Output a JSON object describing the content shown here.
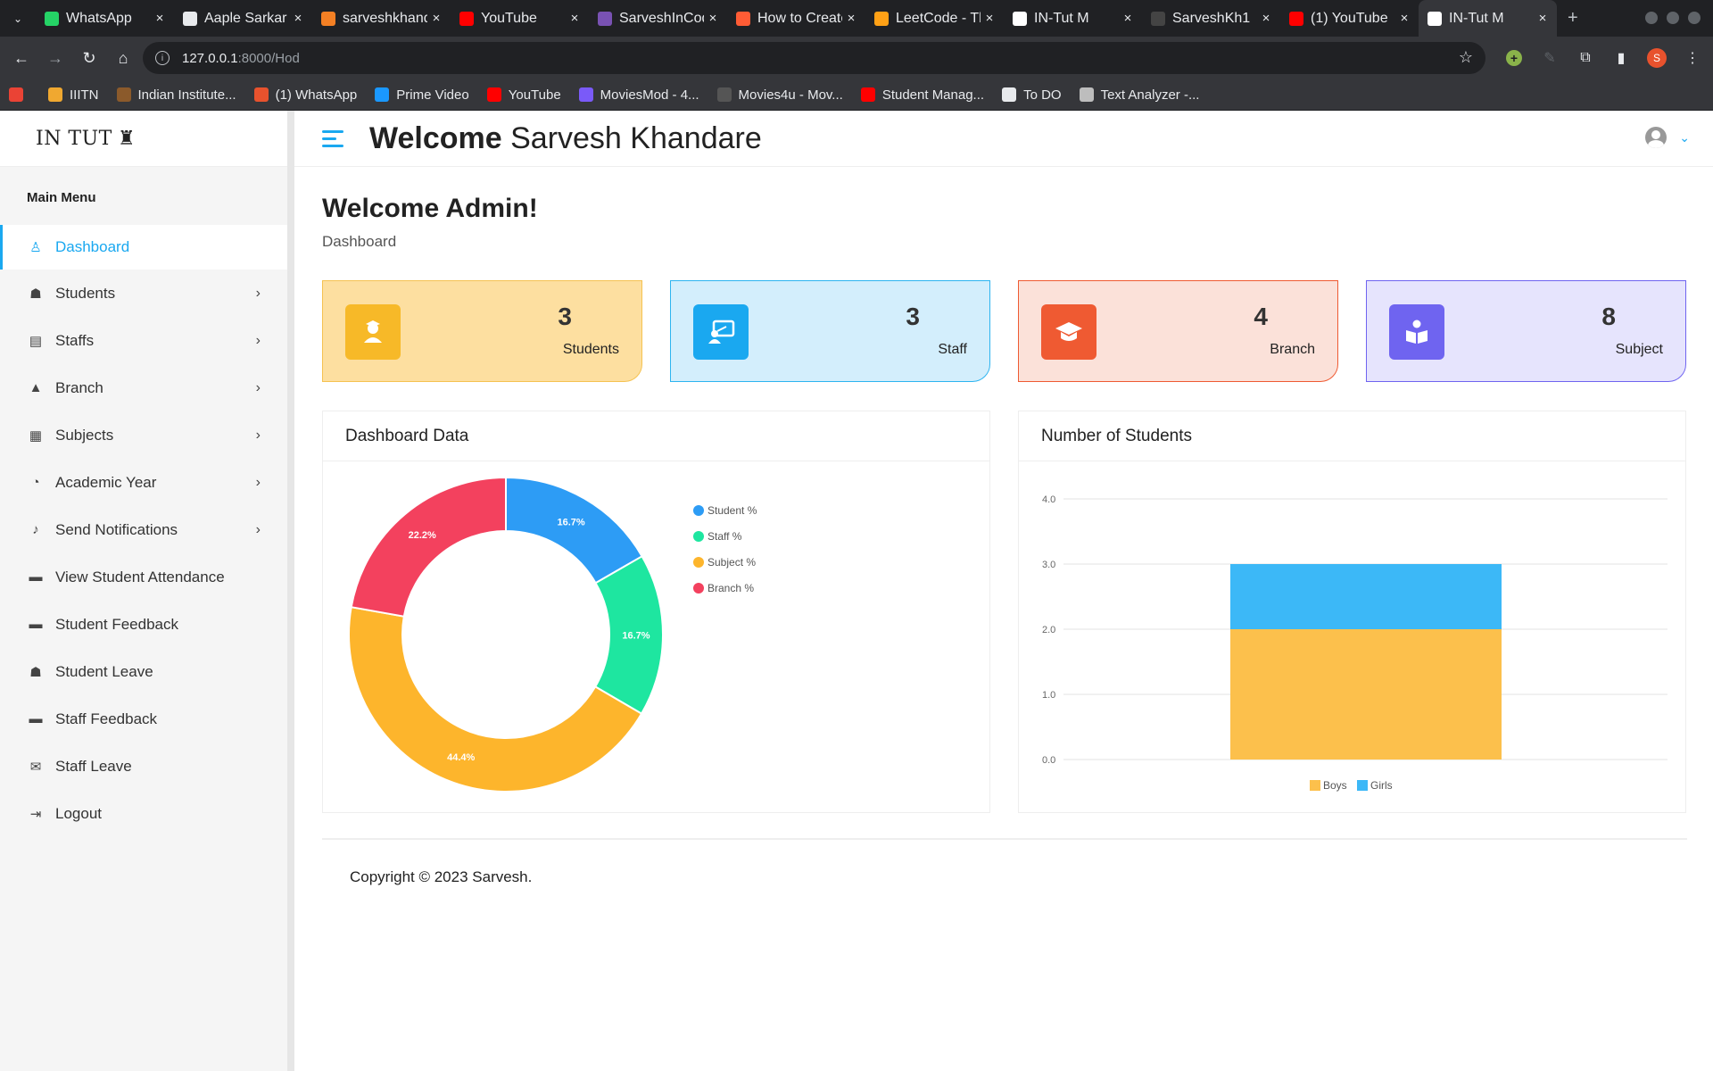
{
  "browser": {
    "tabs": [
      {
        "title": "WhatsApp",
        "icon": "whatsapp-icon",
        "color": "#25d366"
      },
      {
        "title": "Aaple Sarkar",
        "icon": "document-icon",
        "color": "#e8eaed"
      },
      {
        "title": "sarveshkhandare",
        "icon": "stackoverflow-icon",
        "color": "#f48024"
      },
      {
        "title": "YouTube",
        "icon": "youtube-icon",
        "color": "#ff0000"
      },
      {
        "title": "SarveshInCode",
        "icon": "bootstrap-icon",
        "color": "#7952b3"
      },
      {
        "title": "How to Create",
        "icon": "hubspot-icon",
        "color": "#ff5c35"
      },
      {
        "title": "LeetCode - The",
        "icon": "leetcode-icon",
        "color": "#ffa116"
      },
      {
        "title": "IN-Tut M",
        "icon": "intut-icon",
        "color": "#ffffff"
      },
      {
        "title": "SarveshKh1",
        "icon": "github-icon",
        "color": "#444"
      },
      {
        "title": "(1) YouTube",
        "icon": "youtube-icon",
        "color": "#ff0000"
      },
      {
        "title": "IN-Tut M",
        "icon": "intut-icon",
        "color": "#ffffff",
        "active": true
      }
    ],
    "new_tab": "+",
    "url_host": "127.0.0.1",
    "url_path": ":8000/Hod",
    "profile_initial": "S",
    "bookmarks": [
      {
        "label": "",
        "icon": "gmail-icon",
        "color": "#ea4335"
      },
      {
        "label": "IIITN",
        "icon": "iiitn-icon",
        "color": "#f0a830"
      },
      {
        "label": "Indian Institute...",
        "icon": "institute-icon",
        "color": "#8b5a2b"
      },
      {
        "label": "(1) WhatsApp",
        "icon": "whatsapp-icon",
        "color": "#e8522d"
      },
      {
        "label": "Prime Video",
        "icon": "prime-video-icon",
        "color": "#1a98ff"
      },
      {
        "label": "YouTube",
        "icon": "youtube-icon",
        "color": "#ff0000"
      },
      {
        "label": "MoviesMod - 4...",
        "icon": "moviesmod-icon",
        "color": "#7a5af8"
      },
      {
        "label": "Movies4u - Mov...",
        "icon": "movies4u-icon",
        "color": "#555"
      },
      {
        "label": "Student Manag...",
        "icon": "youtube-icon",
        "color": "#ff0000"
      },
      {
        "label": "To DO",
        "icon": "globe-icon",
        "color": "#e8eaed"
      },
      {
        "label": "Text Analyzer -...",
        "icon": "gear-icon",
        "color": "#bdbdbd"
      }
    ]
  },
  "app": {
    "logo_text": "IN TUT",
    "header_welcome": "Welcome",
    "header_user": "Sarvesh Khandare",
    "menu_title": "Main Menu",
    "menu": [
      {
        "label": "Dashboard",
        "icon": "dashboard-icon",
        "active": true,
        "chevron": false
      },
      {
        "label": "Students",
        "icon": "student-icon",
        "chevron": true
      },
      {
        "label": "Staffs",
        "icon": "staff-icon",
        "chevron": true
      },
      {
        "label": "Branch",
        "icon": "graduation-cap-icon",
        "chevron": true
      },
      {
        "label": "Subjects",
        "icon": "book-reader-icon",
        "chevron": true
      },
      {
        "label": "Academic Year",
        "icon": "clock-icon",
        "chevron": true
      },
      {
        "label": "Send Notifications",
        "icon": "bell-icon",
        "chevron": true
      },
      {
        "label": "View Student Attendance",
        "icon": "comments-icon",
        "chevron": false
      },
      {
        "label": "Student Feedback",
        "icon": "comments-icon",
        "chevron": false
      },
      {
        "label": "Student Leave",
        "icon": "student-icon",
        "chevron": false
      },
      {
        "label": "Staff Feedback",
        "icon": "comments-icon",
        "chevron": false
      },
      {
        "label": "Staff Leave",
        "icon": "envelope-icon",
        "chevron": false
      },
      {
        "label": "Logout",
        "icon": "logout-icon",
        "chevron": false
      }
    ],
    "page_title": "Welcome Admin!",
    "breadcrumb": "Dashboard",
    "cards": [
      {
        "value": "3",
        "label": "Students",
        "icon": "student-icon",
        "icon_bg": "#f7b928"
      },
      {
        "value": "3",
        "label": "Staff",
        "icon": "teacher-icon",
        "icon_bg": "#1aa8f0"
      },
      {
        "value": "4",
        "label": "Branch",
        "icon": "graduation-cap-icon",
        "icon_bg": "#ef5a32"
      },
      {
        "value": "8",
        "label": "Subject",
        "icon": "book-reader-icon",
        "icon_bg": "#6f64f0"
      }
    ],
    "panel_left_title": "Dashboard Data",
    "panel_right_title": "Number of Students",
    "footer": "Copyright © 2023 Sarvesh."
  },
  "chart_data": [
    {
      "type": "pie",
      "variant": "doughnut",
      "categories": [
        "Student %",
        "Staff %",
        "Subject %",
        "Branch %"
      ],
      "values": [
        16.7,
        16.7,
        44.4,
        22.2
      ],
      "value_labels": [
        "16.7%",
        "16.7%",
        "44.4%",
        "22.2%"
      ],
      "colors": [
        "#2d9cf5",
        "#1ee6a0",
        "#fdb52c",
        "#f3415e"
      ],
      "legend_position": "right"
    },
    {
      "type": "bar",
      "stacked": true,
      "categories": [
        ""
      ],
      "series": [
        {
          "name": "Boys",
          "values": [
            2
          ],
          "color": "#fcc04c"
        },
        {
          "name": "Girls",
          "values": [
            1
          ],
          "color": "#3cb8f7"
        }
      ],
      "yticks": [
        "0.0",
        "1.0",
        "2.0",
        "3.0",
        "4.0"
      ],
      "ylim": [
        0,
        4
      ],
      "grid": true,
      "legend_position": "bottom"
    }
  ]
}
